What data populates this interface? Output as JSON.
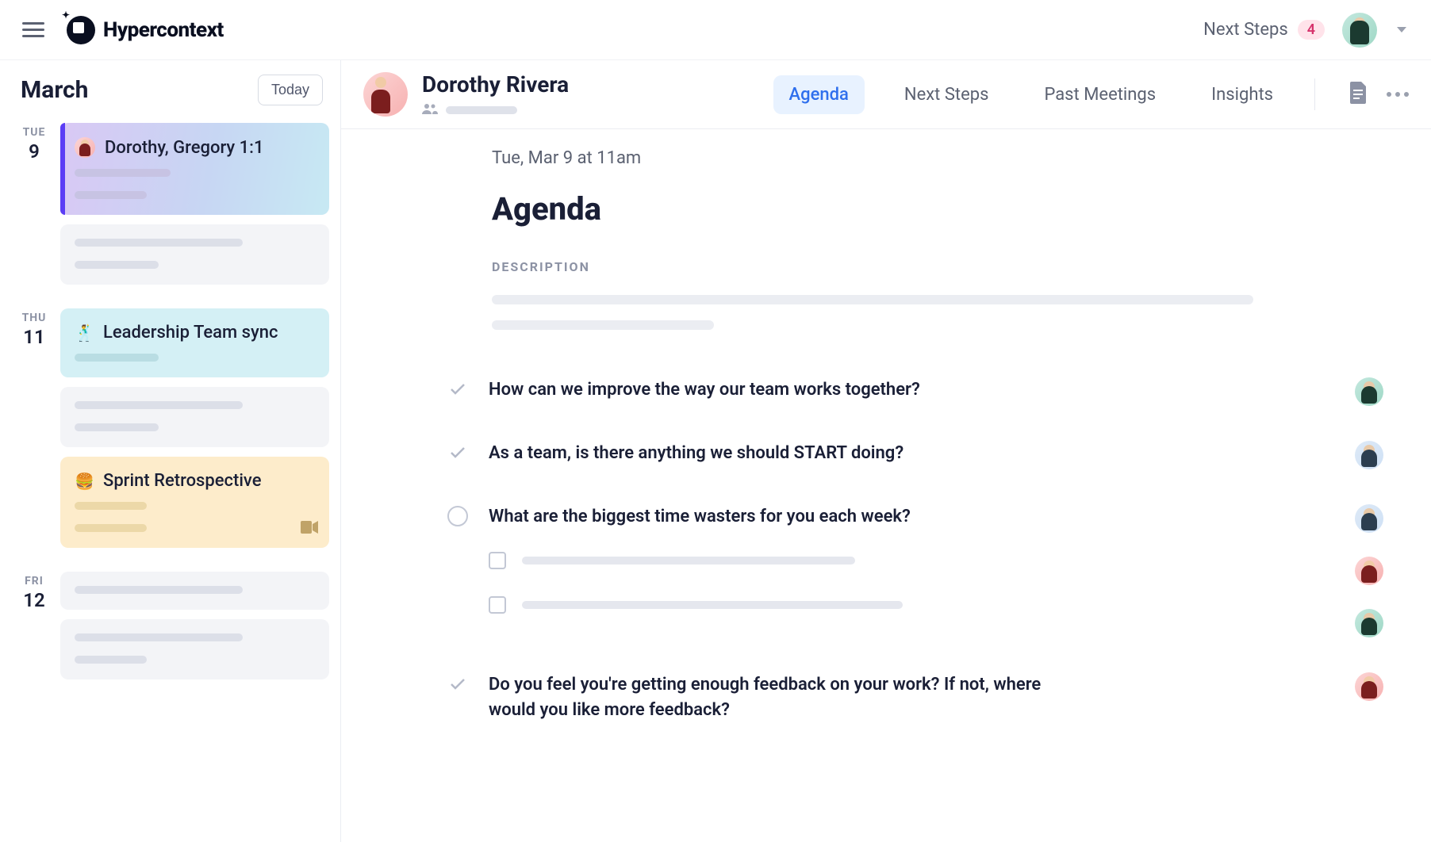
{
  "brand": "Hypercontext",
  "topbar": {
    "next_steps_label": "Next Steps",
    "next_steps_count": "4"
  },
  "sidebar": {
    "month": "March",
    "today_button": "Today",
    "days": [
      {
        "dow": "TUE",
        "num": "9"
      },
      {
        "dow": "THU",
        "num": "11"
      },
      {
        "dow": "FRI",
        "num": "12"
      }
    ],
    "cards": {
      "dorothy_gregory": "Dorothy, Gregory 1:1",
      "leadership": "Leadership Team sync",
      "sprint_retro": "Sprint Retrospective"
    },
    "emoji": {
      "leadership": "🕺",
      "sprint_retro": "🍔"
    }
  },
  "meeting": {
    "person_name": "Dorothy Rivera",
    "tabs": {
      "agenda": "Agenda",
      "next_steps": "Next Steps",
      "past_meetings": "Past Meetings",
      "insights": "Insights"
    }
  },
  "agenda": {
    "datetime": "Tue, Mar 9 at 11am",
    "title": "Agenda",
    "description_label": "DESCRIPTION",
    "items": [
      {
        "text": "How can we improve the way our team works together?"
      },
      {
        "text": "As a team, is there anything we should START doing?"
      },
      {
        "text": "What are the biggest time wasters for you each week?"
      },
      {
        "text": "Do you feel you're getting enough feedback on your work? If not, where would you like more feedback?"
      }
    ]
  }
}
